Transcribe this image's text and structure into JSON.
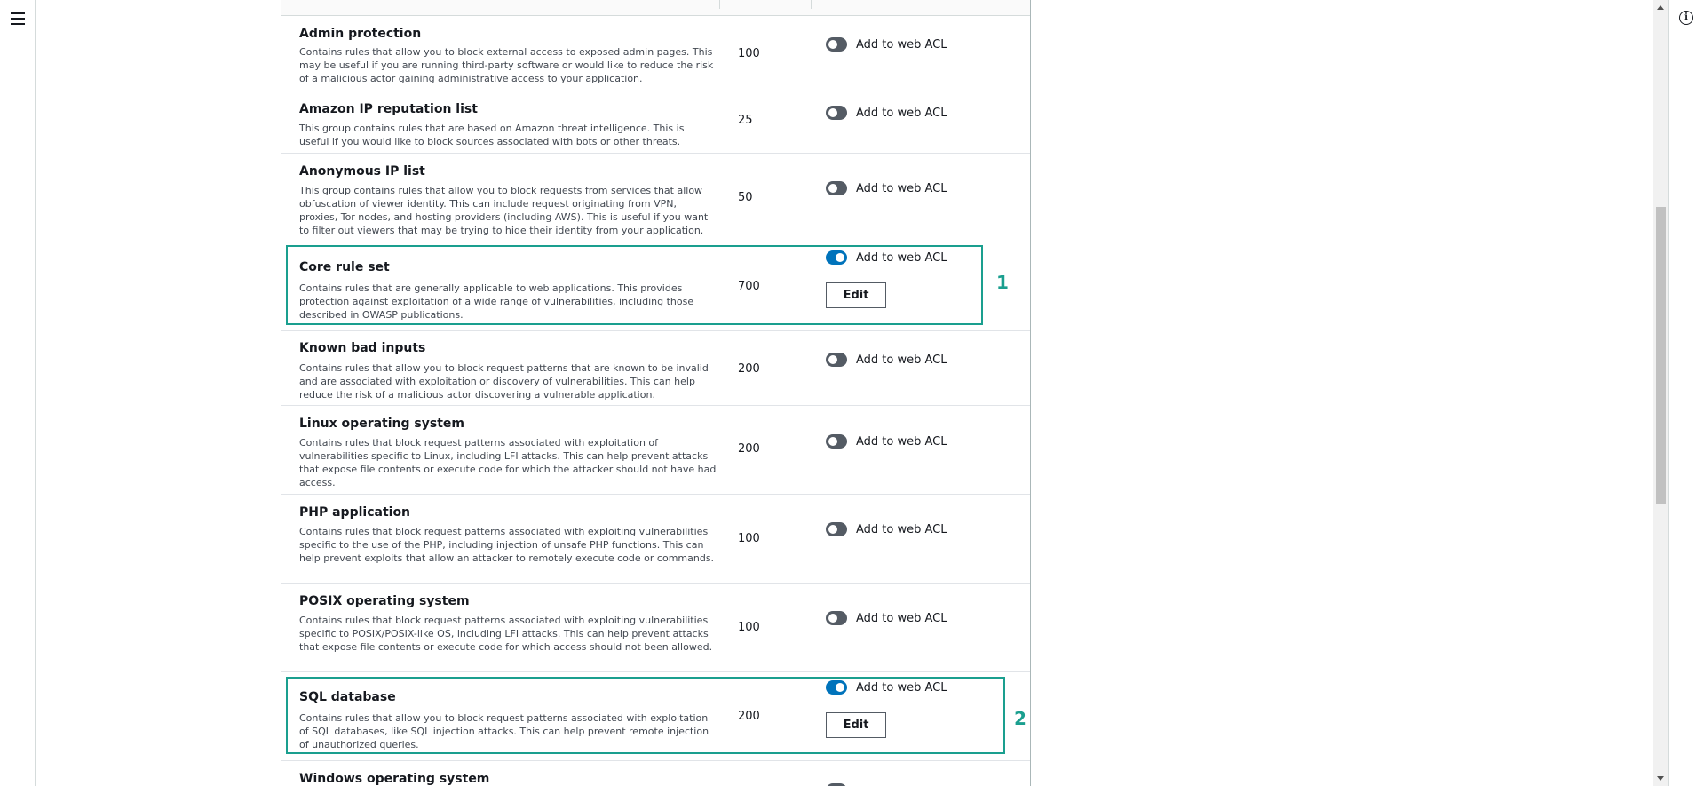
{
  "toggle_label": "Add to web ACL",
  "edit_label": "Edit",
  "rules": [
    {
      "name": "Admin protection",
      "description": "Contains rules that allow you to block external access to exposed admin pages. This may be useful if you are running third-party software or would like to reduce the risk of a malicious actor gaining administrative access to your application.",
      "capacity": "100",
      "enabled": false
    },
    {
      "name": "Amazon IP reputation list",
      "description": "This group contains rules that are based on Amazon threat intelligence. This is useful if you would like to block sources associated with bots or other threats.",
      "capacity": "25",
      "enabled": false
    },
    {
      "name": "Anonymous IP list",
      "description": "This group contains rules that allow you to block requests from services that allow obfuscation of viewer identity. This can include request originating from VPN, proxies, Tor nodes, and hosting providers (including AWS). This is useful if you want to filter out viewers that may be trying to hide their identity from your application.",
      "capacity": "50",
      "enabled": false
    },
    {
      "name": "Core rule set",
      "description": "Contains rules that are generally applicable to web applications. This provides protection against exploitation of a wide range of vulnerabilities, including those described in OWASP publications.",
      "capacity": "700",
      "enabled": true
    },
    {
      "name": "Known bad inputs",
      "description": "Contains rules that allow you to block request patterns that are known to be invalid and are associated with exploitation or discovery of vulnerabilities. This can help reduce the risk of a malicious actor discovering a vulnerable application.",
      "capacity": "200",
      "enabled": false
    },
    {
      "name": "Linux operating system",
      "description": "Contains rules that block request patterns associated with exploitation of vulnerabilities specific to Linux, including LFI attacks. This can help prevent attacks that expose file contents or execute code for which the attacker should not have had access.",
      "capacity": "200",
      "enabled": false
    },
    {
      "name": "PHP application",
      "description": "Contains rules that block request patterns associated with exploiting vulnerabilities specific to the use of the PHP, including injection of unsafe PHP functions. This can help prevent exploits that allow an attacker to remotely execute code or commands.",
      "capacity": "100",
      "enabled": false
    },
    {
      "name": "POSIX operating system",
      "description": "Contains rules that block request patterns associated with exploiting vulnerabilities specific to POSIX/POSIX-like OS, including LFI attacks. This can help prevent attacks that expose file contents or execute code for which access should not been allowed.",
      "capacity": "100",
      "enabled": false
    },
    {
      "name": "SQL database",
      "description": "Contains rules that allow you to block request patterns associated with exploitation of SQL databases, like SQL injection attacks. This can help prevent remote injection of unauthorized queries.",
      "capacity": "200",
      "enabled": true
    },
    {
      "name": "Windows operating system",
      "description": "",
      "capacity": "",
      "enabled": false
    }
  ],
  "callouts": [
    "1",
    "2"
  ],
  "colors": {
    "highlight": "#1a9f8f",
    "toggle_on": "#0073bb",
    "toggle_off": "#545b64"
  }
}
